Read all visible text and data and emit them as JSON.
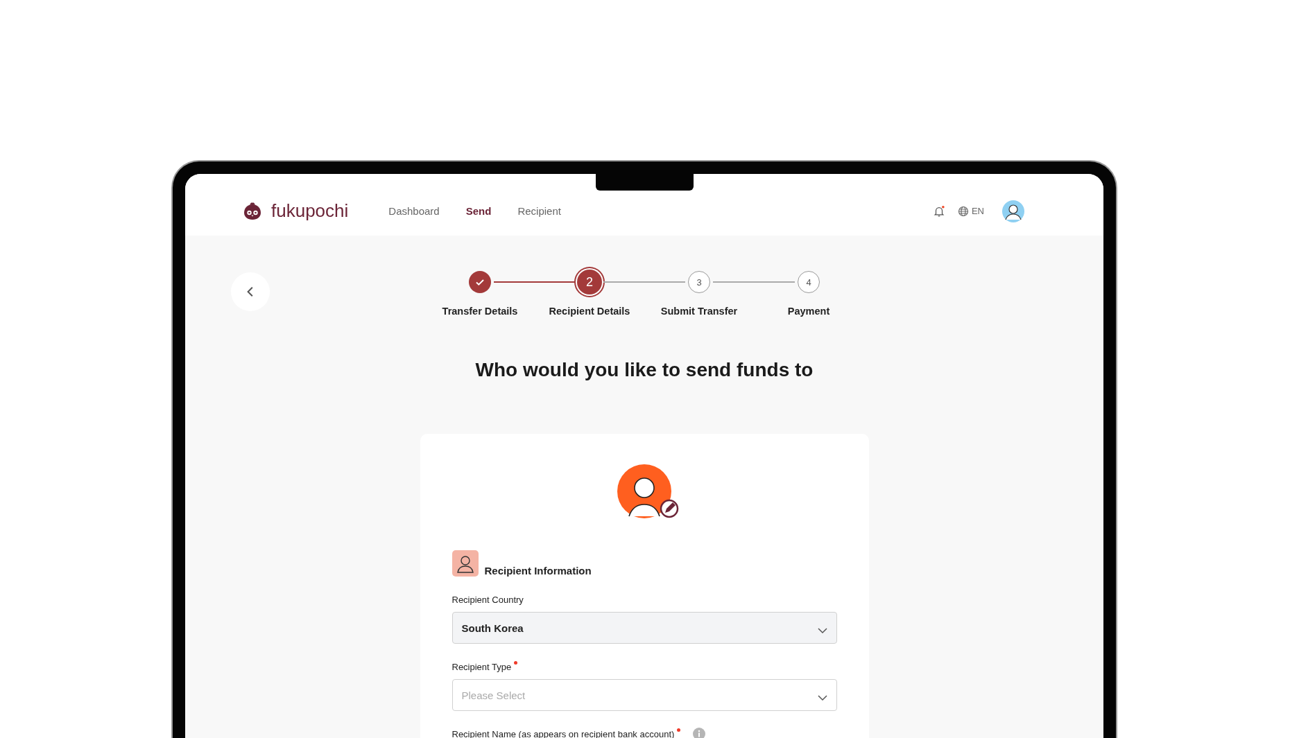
{
  "header": {
    "brand": "fukupochi",
    "nav": [
      {
        "label": "Dashboard",
        "selected": false
      },
      {
        "label": "Send",
        "selected": true
      },
      {
        "label": "Recipient",
        "selected": false
      }
    ],
    "notifications": {
      "unread": true
    },
    "language": "EN"
  },
  "stepper": [
    {
      "label": "Transfer Details",
      "completed": true,
      "selected": false
    },
    {
      "number": "2",
      "label": "Recipient Details",
      "completed": false,
      "selected": true
    },
    {
      "number": "3",
      "label": "Submit Transfer",
      "completed": false,
      "selected": false
    },
    {
      "number": "4",
      "label": "Payment",
      "completed": false,
      "selected": false
    }
  ],
  "heading": "Who would you like to send funds to",
  "form": {
    "section_title": "Recipient Information",
    "fields": [
      {
        "label": "Recipient Country",
        "required": false,
        "info": false,
        "value": "South Korea"
      },
      {
        "label": "Recipient Type",
        "required": true,
        "info": false,
        "placeholder": "Please Select"
      },
      {
        "label": "Recipient Name (as appears on recipient bank account)",
        "required": true,
        "info": true
      }
    ]
  }
}
